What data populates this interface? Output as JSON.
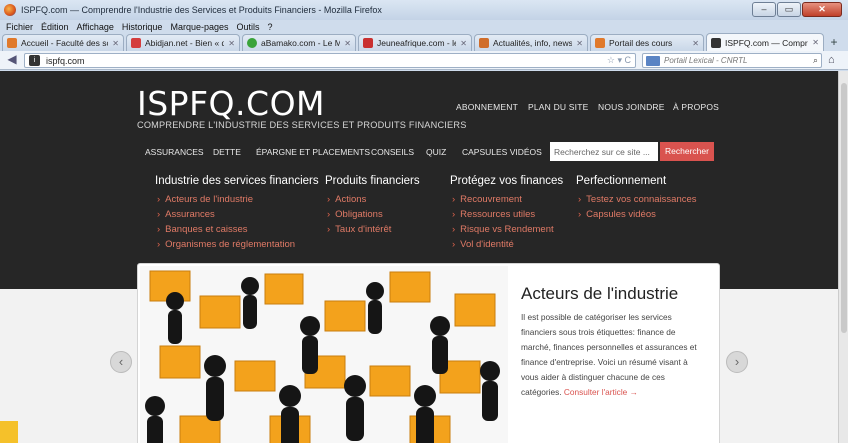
{
  "window": {
    "title": "ISPFQ.com — Comprendre l'Industrie des Services et Produits Financiers - Mozilla Firefox"
  },
  "menu": [
    "Fichier",
    "Édition",
    "Affichage",
    "Historique",
    "Marque-pages",
    "Outils",
    "?"
  ],
  "tabs": [
    {
      "label": "Accueil - Faculté des scien...",
      "color": "#e0792b",
      "active": false
    },
    {
      "label": "Abidjan.net - Bien « qu'u...",
      "color": "#d43d3d",
      "active": false
    },
    {
      "label": "aBamako.com - Le Mali et...",
      "color": "#3aa33a",
      "active": false
    },
    {
      "label": "Jeuneafrique.com - le pre...",
      "color": "#c93030",
      "active": false
    },
    {
      "label": "Actualités, info, news en d...",
      "color": "#d06d2a",
      "active": false
    },
    {
      "label": "Portail des cours",
      "color": "#e0792b",
      "active": false
    },
    {
      "label": "ISPFQ.com — Comprendr...",
      "color": "#333333",
      "active": true
    }
  ],
  "nav": {
    "url": "ispfq.com",
    "search_placeholder": "Portail Lexical - CNRTL"
  },
  "site": {
    "brand": "ISPFQ.COM",
    "tagline": "COMPRENDRE L'INDUSTRIE DES SERVICES ET PRODUITS FINANCIERS",
    "topnav": [
      "ABONNEMENT",
      "PLAN DU SITE",
      "NOUS JOINDRE",
      "À PROPOS"
    ],
    "mainnav": [
      "ASSURANCES",
      "DETTE",
      "ÉPARGNE ET PLACEMENTS",
      "CONSEILS",
      "QUIZ",
      "CAPSULES VIDÉOS"
    ],
    "search_placeholder": "Recherchez sur ce site ...",
    "search_button": "Rechercher",
    "columns": [
      {
        "heading": "Industrie des services financiers",
        "links": [
          "Acteurs de l'industrie",
          "Assurances",
          "Banques et caisses",
          "Organismes de réglementation"
        ]
      },
      {
        "heading": "Produits financiers",
        "links": [
          "Actions",
          "Obligations",
          "Taux d'intérêt"
        ]
      },
      {
        "heading": "Protégez vos finances",
        "links": [
          "Recouvrement",
          "Ressources utiles",
          "Risque vs Rendement",
          "Vol d'identité"
        ]
      },
      {
        "heading": "Perfectionnement",
        "links": [
          "Testez vos connaissances",
          "Capsules vidéos"
        ]
      }
    ],
    "feature": {
      "title": "Acteurs de l'industrie",
      "text": "Il est possible de catégoriser les services financiers sous trois étiquettes: finance de marché, finances personnelles et assurances et finance d'entreprise. Voici un résumé visant à vous aider à distinguer chacune de ces catégories.",
      "more": "Consulter l'article →"
    },
    "prev_arrow": "‹",
    "next_arrow": "›"
  },
  "colors": {
    "header_bg": "#262626",
    "accent": "#d9534f"
  }
}
